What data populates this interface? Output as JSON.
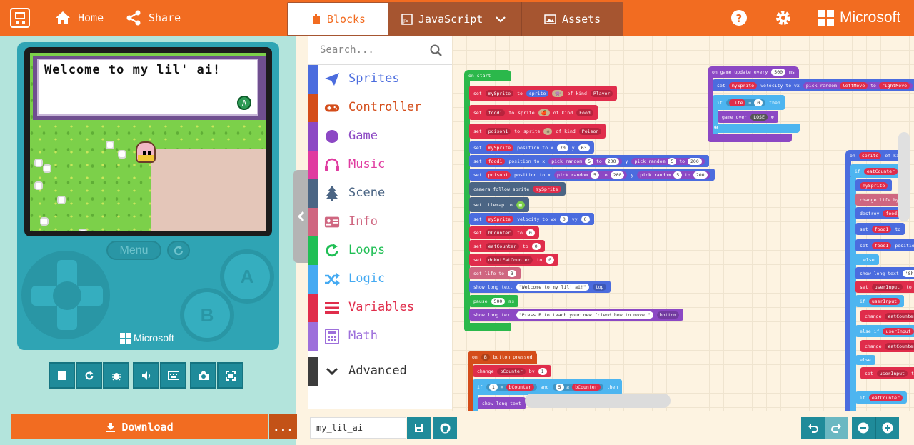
{
  "header": {
    "home_label": "Home",
    "share_label": "Share",
    "brand": "Microsoft"
  },
  "tabs": {
    "blocks": "Blocks",
    "javascript": "JavaScript",
    "assets": "Assets"
  },
  "game": {
    "dialog_text": "Welcome to my lil' ai!",
    "a_badge": "A",
    "menu_label": "Menu",
    "btn_a": "A",
    "btn_b": "B",
    "device_brand": "Microsoft"
  },
  "download": {
    "label": "Download",
    "more": "..."
  },
  "toolbox": {
    "search_placeholder": "Search...",
    "categories": [
      {
        "label": "Sprites",
        "color": "#4b6cde",
        "icon": "paper-plane-icon"
      },
      {
        "label": "Controller",
        "color": "#d44d1a",
        "icon": "gamepad-icon"
      },
      {
        "label": "Game",
        "color": "#8c48c4",
        "icon": "circle-icon"
      },
      {
        "label": "Music",
        "color": "#e03ba0",
        "icon": "headphones-icon"
      },
      {
        "label": "Scene",
        "color": "#4b6584",
        "icon": "tree-icon"
      },
      {
        "label": "Info",
        "color": "#cf6680",
        "icon": "id-card-icon"
      },
      {
        "label": "Loops",
        "color": "#20bf55",
        "icon": "loop-icon"
      },
      {
        "label": "Logic",
        "color": "#45aaf2",
        "icon": "shuffle-icon"
      },
      {
        "label": "Variables",
        "color": "#e02d4b",
        "icon": "list-icon"
      },
      {
        "label": "Math",
        "color": "#9d6fdb",
        "icon": "calculator-icon"
      },
      {
        "label": "Advanced",
        "color": "#3c3c3c",
        "icon": "chevron-down-icon"
      }
    ]
  },
  "project": {
    "name": "my_lil_ai"
  },
  "blocks": {
    "on_start": "on start",
    "set": "set",
    "to": "to",
    "sprite": "sprite",
    "of_kind": "of kind",
    "mySprite": "mySprite",
    "food1": "food1",
    "poison1": "poison1",
    "player": "Player",
    "food": "Food",
    "poison": "Poison",
    "position_to_x": "position to x",
    "y": "y",
    "x_val": "70",
    "y_val": "63",
    "pick_random": "pick random",
    "r5": "5",
    "r200": "200",
    "camera_follow": "camera follow sprite",
    "set_tilemap": "set tilemap to",
    "velocity": "velocity to vx",
    "vy": "vy",
    "zero": "0",
    "bCounter": "bCounter",
    "eatCounter": "eatCounter",
    "doNotEatCounter": "doNotEatCounter",
    "set_life": "set life to",
    "life_val": "3",
    "show_long_text": "show long text",
    "welcome": "\"Welcome to my lil' ai!\"",
    "top": "top",
    "pause": "pause",
    "pause_val": "500",
    "ms": "ms",
    "press_b": "\"Press B to teach your new friend how to move.\"",
    "bottom": "bottom",
    "on_b": "on",
    "b_btn": "B",
    "button_pressed": "button pressed",
    "change": "change",
    "by": "by",
    "one": "1",
    "if": "if",
    "eq": "=",
    "and": "and",
    "then": "then",
    "five": "5",
    "ge": "≥",
    "on_update": "on game update every",
    "update_ms": "500",
    "leftMove": "leftMove",
    "rightMove": "rightMove",
    "life": "life",
    "game_over": "game over",
    "lose": "LOSE",
    "on_sprite": "on",
    "of_kind_short": "of kind",
    "change_life": "change life by",
    "destroy": "destroy",
    "position_short": "position",
    "else": "else",
    "else_if": "else if",
    "should": "'Should",
    "userInput": "userInput",
    "change_eat": "eatCounter"
  }
}
